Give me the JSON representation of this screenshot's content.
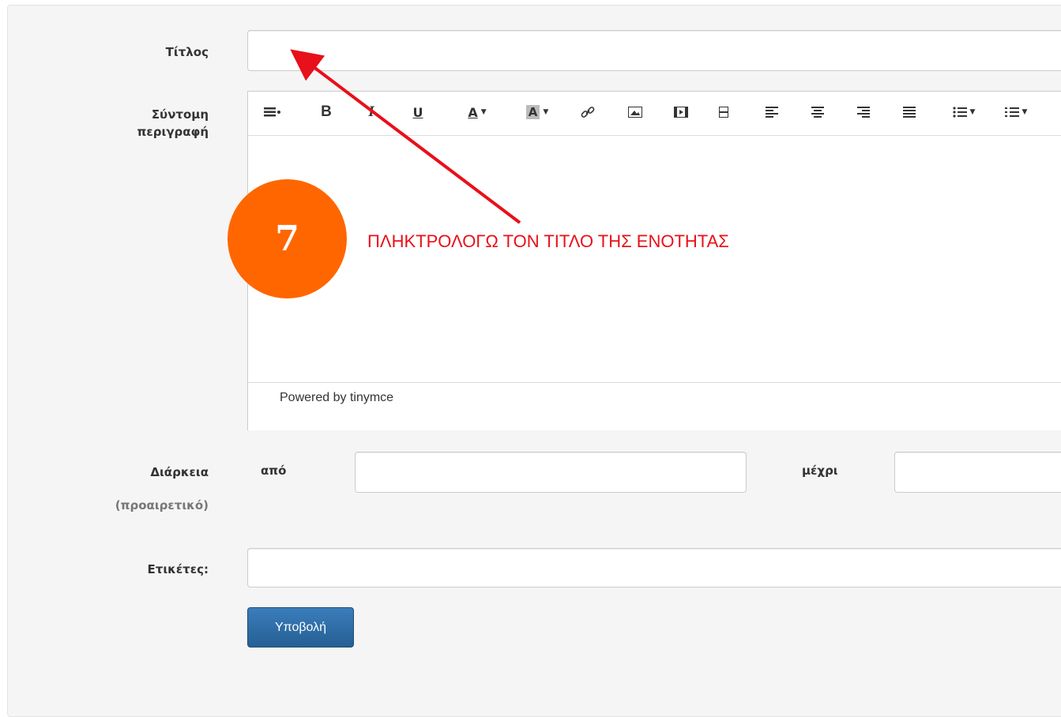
{
  "form": {
    "title_label": "Τίτλος",
    "title_value": "",
    "description_label_1": "Σύντομη",
    "description_label_2": "περιγραφή",
    "editor_footer": "Powered by tinymce",
    "duration_label": "Διάρκεια",
    "duration_optional": "(προαιρετικό)",
    "from_label": "από",
    "from_value": "",
    "to_label": "μέχρι",
    "to_value": "",
    "tags_label": "Ετικέτες:",
    "tags_value": "",
    "submit_label": "Υποβολή"
  },
  "toolbar": {
    "items": [
      {
        "name": "paragraph-format-icon",
        "glyph": "≡▸"
      },
      {
        "name": "bold-icon",
        "glyph": "B"
      },
      {
        "name": "italic-icon",
        "glyph": "I"
      },
      {
        "name": "underline-icon",
        "glyph": "U"
      },
      {
        "name": "text-color-icon",
        "glyph": "A"
      },
      {
        "name": "background-color-icon",
        "glyph": "A"
      },
      {
        "name": "link-icon",
        "glyph": "🔗"
      },
      {
        "name": "image-icon",
        "glyph": "▣"
      },
      {
        "name": "media-icon",
        "glyph": "▶"
      },
      {
        "name": "pagebreak-icon",
        "glyph": "▤"
      },
      {
        "name": "align-left-icon",
        "glyph": "≡"
      },
      {
        "name": "align-center-icon",
        "glyph": "≡"
      },
      {
        "name": "align-right-icon",
        "glyph": "≡"
      },
      {
        "name": "align-justify-icon",
        "glyph": "≡"
      },
      {
        "name": "bullet-list-icon",
        "glyph": "☰"
      },
      {
        "name": "numbered-list-icon",
        "glyph": "☰"
      }
    ]
  },
  "annotation": {
    "step_number": "7",
    "instruction": "ΠΛΗΚΤΡΟΛΟΓΩ ΤΟΝ ΤΙΤΛΟ ΤΗΣ ΕΝΟΤΗΤΑΣ",
    "arrow_color": "#e8101a",
    "badge_color": "#ff6600"
  },
  "colors": {
    "panel_bg": "#f5f5f5",
    "submit_bg": "#2e6da4"
  }
}
